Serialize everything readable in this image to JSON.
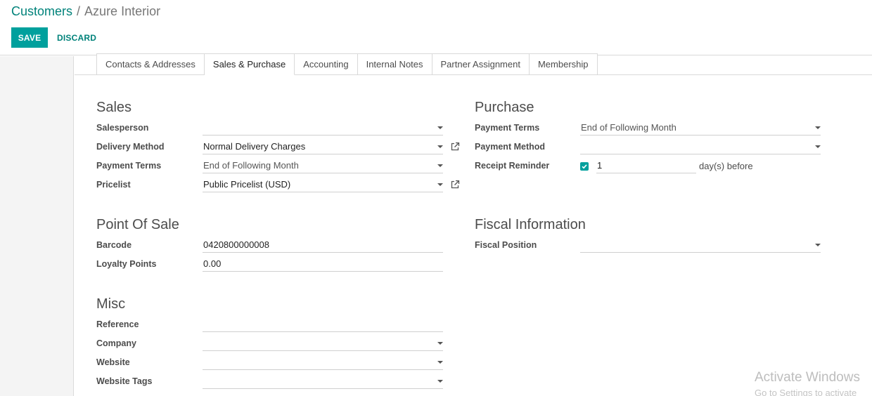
{
  "breadcrumb": {
    "parent": "Customers",
    "separator": "/",
    "current": "Azure Interior"
  },
  "actions": {
    "save_label": "SAVE",
    "discard_label": "DISCARD"
  },
  "tabs": [
    {
      "label": "Contacts & Addresses"
    },
    {
      "label": "Sales & Purchase"
    },
    {
      "label": "Accounting"
    },
    {
      "label": "Internal Notes"
    },
    {
      "label": "Partner Assignment"
    },
    {
      "label": "Membership"
    }
  ],
  "active_tab": "Sales & Purchase",
  "sales": {
    "title": "Sales",
    "salesperson": {
      "label": "Salesperson",
      "value": ""
    },
    "delivery_method": {
      "label": "Delivery Method",
      "value": "Normal Delivery Charges"
    },
    "payment_terms": {
      "label": "Payment Terms",
      "value": "End of Following Month"
    },
    "pricelist": {
      "label": "Pricelist",
      "value": "Public Pricelist (USD)"
    }
  },
  "point_of_sale": {
    "title": "Point Of Sale",
    "barcode": {
      "label": "Barcode",
      "value": "0420800000008"
    },
    "loyalty_points": {
      "label": "Loyalty Points",
      "value": "0.00"
    }
  },
  "misc": {
    "title": "Misc",
    "reference": {
      "label": "Reference",
      "value": ""
    },
    "company": {
      "label": "Company",
      "value": ""
    },
    "website": {
      "label": "Website",
      "value": ""
    },
    "website_tags": {
      "label": "Website Tags",
      "value": ""
    }
  },
  "purchase": {
    "title": "Purchase",
    "payment_terms": {
      "label": "Payment Terms",
      "value": "End of Following Month"
    },
    "payment_method": {
      "label": "Payment Method",
      "value": ""
    },
    "receipt_reminder": {
      "label": "Receipt Reminder",
      "checked": true,
      "days": "1",
      "suffix": "day(s) before"
    }
  },
  "fiscal": {
    "title": "Fiscal Information",
    "fiscal_position": {
      "label": "Fiscal Position",
      "value": ""
    }
  },
  "watermark": {
    "title": "Activate Windows",
    "subtitle": "Go to Settings to activate"
  },
  "colors": {
    "primary": "#00a09d",
    "link": "#00827a",
    "text": "#4c4c4c"
  }
}
